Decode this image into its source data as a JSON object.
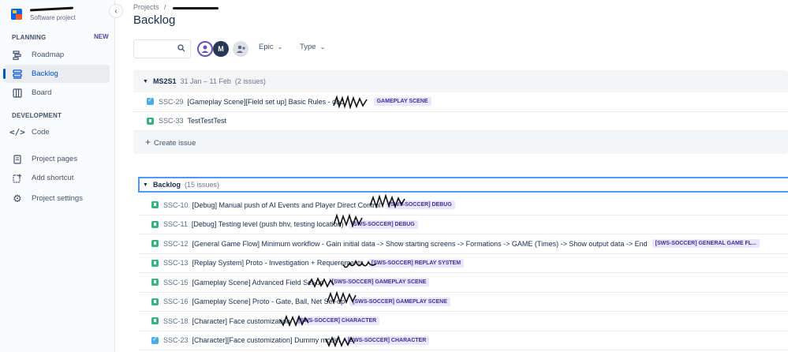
{
  "sidebar": {
    "project_type": "Software project",
    "collapse_icon": "chevron-left-icon",
    "planning_label": "PLANNING",
    "new_badge": "NEW",
    "development_label": "DEVELOPMENT",
    "items": [
      {
        "label": "Roadmap",
        "icon": "roadmap-icon"
      },
      {
        "label": "Backlog",
        "icon": "backlog-icon",
        "active": true
      },
      {
        "label": "Board",
        "icon": "board-icon"
      },
      {
        "label": "Code",
        "icon": "code-icon"
      },
      {
        "label": "Project pages",
        "icon": "page-icon"
      },
      {
        "label": "Add shortcut",
        "icon": "add-shortcut-icon"
      },
      {
        "label": "Project settings",
        "icon": "gear-icon"
      }
    ]
  },
  "header": {
    "breadcrumb_root": "Projects",
    "breadcrumb_sep": "/",
    "title": "Backlog"
  },
  "toolbar": {
    "search_placeholder": "",
    "avatar_m": "M",
    "epic_label": "Epic",
    "type_label": "Type"
  },
  "sprint": {
    "name": "MS2S1",
    "dates": "31 Jan – 11 Feb",
    "count": "(2 issues)",
    "create_label": "Create issue",
    "issues": [
      {
        "type": "task",
        "key": "SSC-29",
        "summary": "[Gameplay Scene][Field set up] Basic Rules - doc",
        "epic": "GAMEPLAY SCENE"
      },
      {
        "type": "story",
        "key": "SSC-33",
        "summary": "TestTestTest",
        "epic": ""
      }
    ]
  },
  "backlog": {
    "name": "Backlog",
    "count": "(15 issues)",
    "issues": [
      {
        "type": "story",
        "key": "SSC-10",
        "summary": "[Debug] Manual push of AI Events and Player Direct Control",
        "epic": "[SWS-SOCCER] DEBUG"
      },
      {
        "type": "story",
        "key": "SSC-11",
        "summary": "[Debug] Testing level (push bhv, testing location)",
        "epic": "[SWS-SOCCER] DEBUG"
      },
      {
        "type": "story",
        "key": "SSC-12",
        "summary": "[General Game Flow] Minimum workflow - Gain initial data -> Show starting screens -> Formations -> GAME (Times) -> Show output data -> End",
        "epic": "[SWS-SOCCER] GENERAL GAME FL..."
      },
      {
        "type": "story",
        "key": "SSC-13",
        "summary": "[Replay System] Proto - Investigation + Requerements",
        "epic": "[SWS-SOCCER] REPLAY SYSTEM"
      },
      {
        "type": "story",
        "key": "SSC-15",
        "summary": "[Gameplay Scene] Advanced Field Set-up",
        "epic": "[SWS-SOCCER] GAMEPLAY SCENE"
      },
      {
        "type": "story",
        "key": "SSC-16",
        "summary": "[Gameplay Scene] Proto - Gate, Ball, Net Set-up",
        "epic": "[SWS-SOCCER] GAMEPLAY SCENE"
      },
      {
        "type": "story",
        "key": "SSC-18",
        "summary": "[Character] Face customization",
        "epic": "[SWS-SOCCER] CHARACTER"
      },
      {
        "type": "task",
        "key": "SSC-23",
        "summary": "[Character][Face customization] Dummy model",
        "epic": "[SWS-SOCCER] CHARACTER"
      }
    ]
  }
}
